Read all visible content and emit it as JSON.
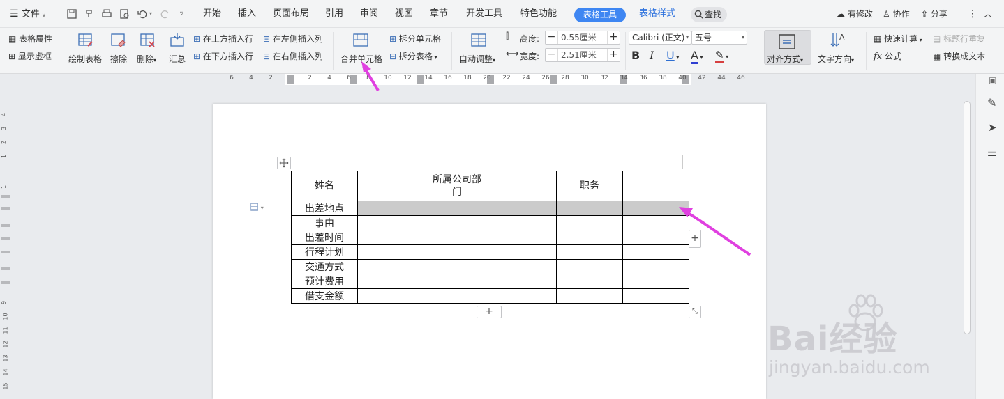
{
  "menubar": {
    "file": "文件",
    "tabs": [
      "开始",
      "插入",
      "页面布局",
      "引用",
      "审阅",
      "视图",
      "章节",
      "开发工具",
      "特色功能",
      "表格工具",
      "表格样式"
    ],
    "find": "查找",
    "modified": "有修改",
    "collab": "协作",
    "share": "分享"
  },
  "ribbon": {
    "table_props": "表格属性",
    "show_grid": "显示虚框",
    "draw_table": "绘制表格",
    "erase": "擦除",
    "delete": "删除",
    "summary": "汇总",
    "insert_above": "在上方插入行",
    "insert_below": "在下方插入行",
    "insert_left": "在左侧插入列",
    "insert_right": "在右侧插入列",
    "merge_cells": "合并单元格",
    "split_cells": "拆分单元格",
    "split_table": "拆分表格",
    "auto_fit": "自动调整",
    "height_label": "高度:",
    "height_value": "0.55厘米",
    "width_label": "宽度:",
    "width_value": "2.51厘米",
    "font_name": "Calibri (正文)",
    "font_size": "五号",
    "bold": "B",
    "italic": "I",
    "underline": "U",
    "font_color": "A",
    "align": "对齐方式",
    "text_dir": "文字方向",
    "quick_calc": "快速计算",
    "repeat_header": "标题行重复",
    "formula_icon": "fx",
    "formula": "公式",
    "to_text": "转换成文本"
  },
  "ruler_numbers": [
    "6",
    "4",
    "2",
    "2",
    "4",
    "6",
    "8",
    "10",
    "12",
    "14",
    "16",
    "18",
    "20",
    "22",
    "24",
    "26",
    "28",
    "30",
    "32",
    "34",
    "36",
    "38",
    "40",
    "42",
    "44",
    "46"
  ],
  "vruler_numbers": [
    "4",
    "3",
    "2",
    "1",
    "1",
    "9",
    "10",
    "11",
    "12",
    "13",
    "14",
    "15"
  ],
  "table": {
    "rows": [
      [
        "姓名",
        "",
        "所属公司部门",
        "",
        "职务",
        ""
      ],
      [
        "出差地点",
        "",
        "",
        "",
        "",
        ""
      ],
      [
        "事由",
        "",
        "",
        "",
        "",
        ""
      ],
      [
        "出差时间",
        "",
        "",
        "",
        "",
        ""
      ],
      [
        "行程计划",
        "",
        "",
        "",
        "",
        ""
      ],
      [
        "交通方式",
        "",
        "",
        "",
        "",
        ""
      ],
      [
        "预计费用",
        "",
        "",
        "",
        "",
        ""
      ],
      [
        "借支金额",
        "",
        "",
        "",
        "",
        ""
      ]
    ],
    "selected_row": 1
  },
  "colors": {
    "accent": "#3e86f2",
    "arrow": "#e040e0",
    "selection": "#cbcbcb"
  },
  "watermark": {
    "brand": "Bai经验",
    "url": "jingyan.baidu.com"
  }
}
